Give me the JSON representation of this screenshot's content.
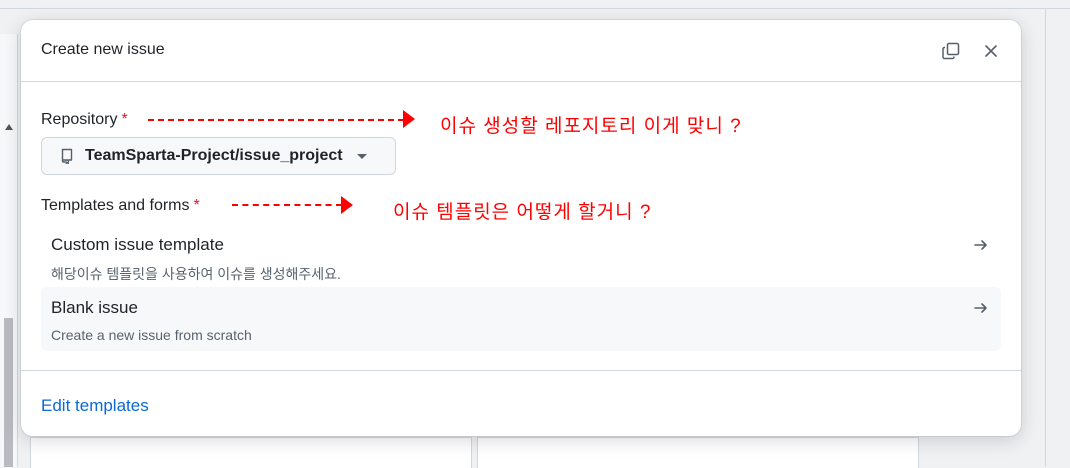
{
  "modal": {
    "title": "Create new issue",
    "repository_label": "Repository",
    "required_mark": "*",
    "repository_value": "TeamSparta-Project/issue_project",
    "templates_label": "Templates and forms",
    "templates": [
      {
        "title": "Custom issue template",
        "description": "해당이슈 템플릿을 사용하여 이슈를 생성해주세요."
      },
      {
        "title": "Blank issue",
        "description": "Create a new issue from scratch"
      }
    ],
    "edit_templates_link": "Edit templates"
  },
  "annotations": [
    {
      "text": "이슈 생성할 레포지토리 이게 맞니 ?"
    },
    {
      "text": "이슈 템플릿은 어떻게 할거니 ?"
    }
  ],
  "colors": {
    "accent_link": "#0969da",
    "required": "#d1242f",
    "annotation": "#ff0000"
  },
  "icons": {
    "copy": "copy-icon",
    "close": "close-icon",
    "repo": "repo-icon",
    "dropdown": "triangle-down-icon",
    "arrow": "arrow-right-icon"
  }
}
